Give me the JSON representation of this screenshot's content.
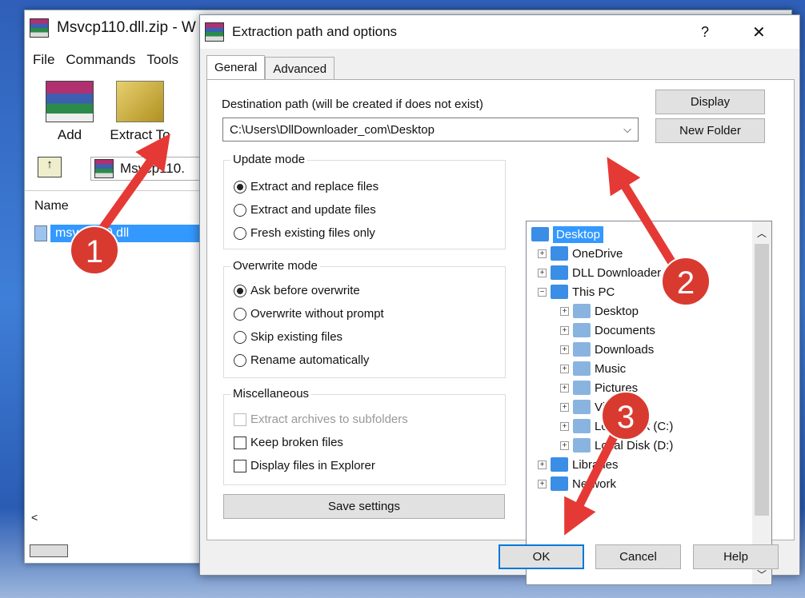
{
  "winrar": {
    "title": "Msvcp110.dll.zip - W",
    "menu": [
      "File",
      "Commands",
      "Tools"
    ],
    "toolbar": [
      "Add",
      "Extract To"
    ],
    "path": "Msvcp110.",
    "column_name": "Name",
    "file": "msvcp110.dll"
  },
  "dialog": {
    "title": "Extraction path and options",
    "help_icon": "?",
    "close_icon": "✕",
    "tabs": [
      "General",
      "Advanced"
    ],
    "dest_label": "Destination path (will be created if does not exist)",
    "dest_value": "C:\\Users\\DllDownloader_com\\Desktop",
    "display_button": "Display",
    "new_folder_button": "New Folder",
    "update_mode": {
      "label": "Update mode",
      "options": [
        "Extract and replace files",
        "Extract and update files",
        "Fresh existing files only"
      ],
      "selected": 0
    },
    "overwrite_mode": {
      "label": "Overwrite mode",
      "options": [
        "Ask before overwrite",
        "Overwrite without prompt",
        "Skip existing files",
        "Rename automatically"
      ],
      "selected": 0
    },
    "misc": {
      "label": "Miscellaneous",
      "options": [
        {
          "label": "Extract archives to subfolders",
          "checked": false,
          "disabled": true
        },
        {
          "label": "Keep broken files",
          "checked": false,
          "disabled": false
        },
        {
          "label": "Display files in Explorer",
          "checked": false,
          "disabled": false
        }
      ]
    },
    "save_settings": "Save settings",
    "tree": [
      {
        "label": "Desktop",
        "level": 0,
        "selected": true
      },
      {
        "label": "OneDrive",
        "level": 1,
        "exp": "+"
      },
      {
        "label": "DLL Downloader.com",
        "level": 1,
        "exp": "+"
      },
      {
        "label": "This PC",
        "level": 1,
        "exp": "-"
      },
      {
        "label": "Desktop",
        "level": 2,
        "exp": "+"
      },
      {
        "label": "Documents",
        "level": 2,
        "exp": "+"
      },
      {
        "label": "Downloads",
        "level": 2,
        "exp": "+"
      },
      {
        "label": "Music",
        "level": 2,
        "exp": "+"
      },
      {
        "label": "Pictures",
        "level": 2,
        "exp": "+"
      },
      {
        "label": "Videos",
        "level": 2,
        "exp": "+"
      },
      {
        "label": "Local Disk (C:)",
        "level": 2,
        "exp": "+"
      },
      {
        "label": "Local Disk (D:)",
        "level": 2,
        "exp": "+"
      },
      {
        "label": "Libraries",
        "level": 1,
        "exp": "+"
      },
      {
        "label": "Network",
        "level": 1,
        "exp": "+"
      }
    ],
    "ok": "OK",
    "cancel": "Cancel",
    "help": "Help"
  },
  "annotations": [
    "1",
    "2",
    "3"
  ],
  "colors": {
    "selection": "#3399ff",
    "arrow": "#e53935"
  }
}
